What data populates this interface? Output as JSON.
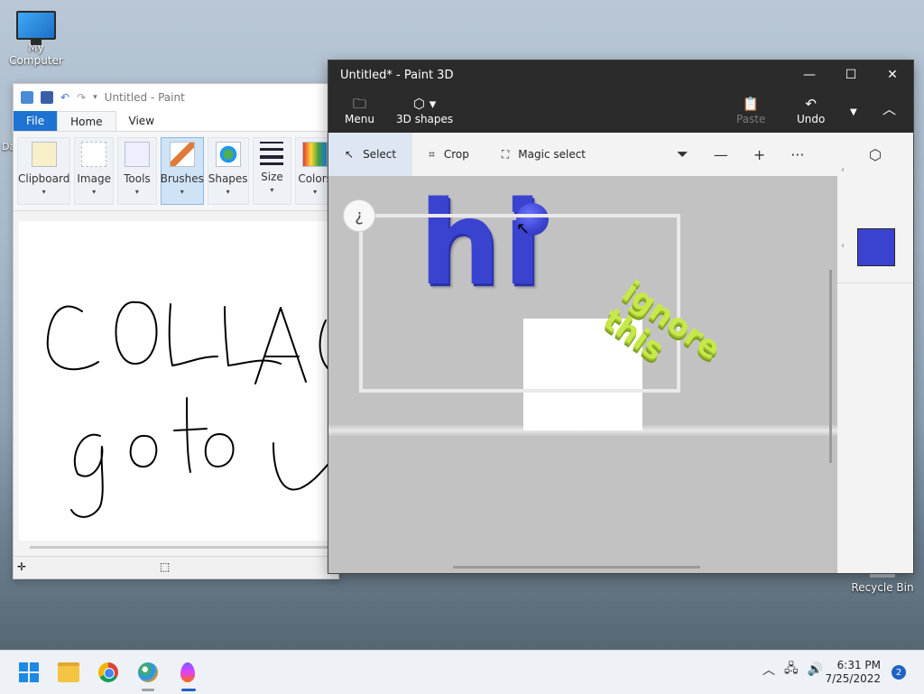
{
  "desktop": {
    "icons": [
      {
        "label": "My Computer"
      },
      {
        "label": "Recycle Bin"
      }
    ],
    "left_edge_label": "Da"
  },
  "paint": {
    "title": "Untitled - Paint",
    "tabs": [
      "File",
      "Home",
      "View"
    ],
    "active_tab": "Home",
    "ribbon": [
      {
        "label": "Clipboard"
      },
      {
        "label": "Image"
      },
      {
        "label": "Tools"
      },
      {
        "label": "Brushes"
      },
      {
        "label": "Shapes"
      },
      {
        "label": "Size"
      },
      {
        "label": "Colors"
      }
    ],
    "selected_group": "Brushes",
    "canvas_handwriting": [
      "COLLAB",
      "go to"
    ]
  },
  "paint3d": {
    "title": "Untitled* - Paint 3D",
    "top_tools": {
      "menu": "Menu",
      "shapes": "3D shapes",
      "paste": "Paste",
      "undo": "Undo"
    },
    "subbar": {
      "select": "Select",
      "crop": "Crop",
      "magic_select": "Magic select"
    },
    "active_tool": "Select",
    "info_glyph": "¿",
    "canvas_text_3d": "hi",
    "canvas_text_overlay": "ignore this",
    "selected_color": "#3a43d0",
    "overlay_color": "#c6e84a"
  },
  "taskbar": {
    "apps": [
      "start-icon",
      "file-explorer-icon",
      "chrome-icon",
      "paint-icon",
      "paint3d-icon"
    ],
    "time": "6:31 PM",
    "date": "7/25/2022",
    "notifications": "2"
  }
}
